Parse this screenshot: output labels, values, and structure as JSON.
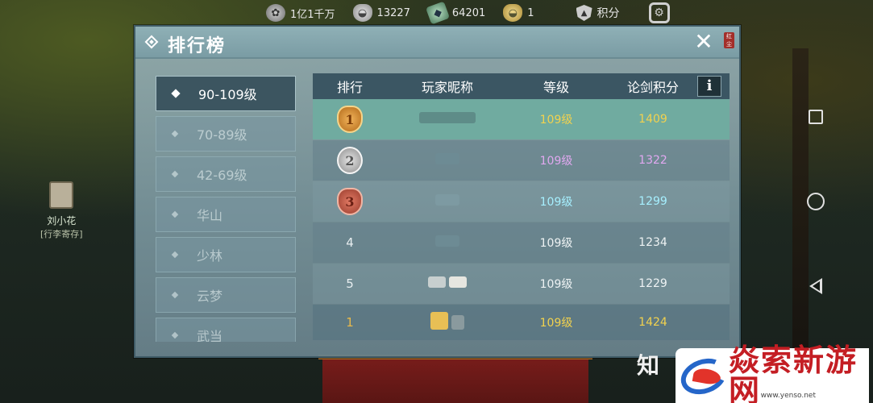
{
  "topbar": {
    "silver": "1亿1千万",
    "ingot": "13227",
    "jade": "64201",
    "gold": "1",
    "points_label": "积分"
  },
  "panel": {
    "title": "排行榜",
    "close": "✕",
    "seal": "红尘"
  },
  "categories": [
    {
      "label": "90-109级",
      "active": true
    },
    {
      "label": "70-89级",
      "active": false
    },
    {
      "label": "42-69级",
      "active": false
    },
    {
      "label": "华山",
      "active": false
    },
    {
      "label": "少林",
      "active": false
    },
    {
      "label": "云梦",
      "active": false
    },
    {
      "label": "武当",
      "active": false
    }
  ],
  "table": {
    "headers": {
      "rank": "排行",
      "name": "玩家昵称",
      "level": "等级",
      "score": "论剑积分"
    },
    "info": "i",
    "rows": [
      {
        "rank": "1",
        "medal": "gold",
        "level": "109级",
        "score": "1409",
        "tone": "gold"
      },
      {
        "rank": "2",
        "medal": "silver",
        "level": "109级",
        "score": "1322",
        "tone": "purple"
      },
      {
        "rank": "3",
        "medal": "bronze",
        "level": "109级",
        "score": "1299",
        "tone": "blue"
      },
      {
        "rank": "4",
        "level": "109级",
        "score": "1234",
        "tone": "white"
      },
      {
        "rank": "5",
        "level": "109级",
        "score": "1229",
        "tone": "white"
      },
      {
        "rank": "1",
        "level": "109级",
        "score": "1424",
        "tone": "gold"
      }
    ]
  },
  "npc": {
    "name": "刘小花",
    "subtitle": "[行李寄存]"
  },
  "watermark": {
    "zhi": "知",
    "site": "焱索新游网",
    "url": "www.yenso.net"
  },
  "colors": {
    "highlight_row": "#70aba0",
    "header": "#3b5663",
    "gold_text": "#f2d24e"
  }
}
